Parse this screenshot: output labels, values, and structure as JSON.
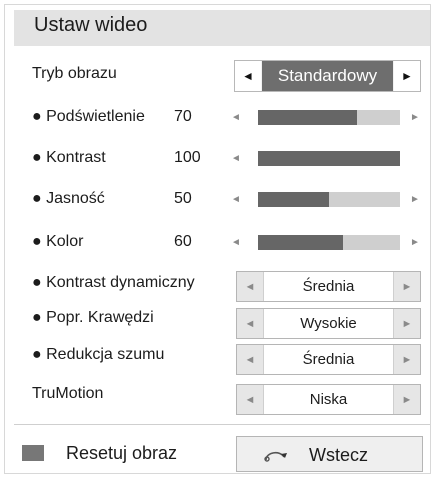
{
  "header": {
    "title": "Ustaw wideo"
  },
  "picture_mode": {
    "label": "Tryb obrazu",
    "value": "Standardowy",
    "left": "◄",
    "right": "►"
  },
  "sliders": [
    {
      "label": "● Podświetlenie",
      "value": "70",
      "level": 70
    },
    {
      "label": "● Kontrast",
      "value": "100",
      "level": 100
    },
    {
      "label": "● Jasność",
      "value": "50",
      "level": 50
    },
    {
      "label": "● Kolor",
      "value": "60",
      "level": 60
    }
  ],
  "selectors": [
    {
      "label": "● Kontrast dynamiczny",
      "value": "Średnia"
    },
    {
      "label": "● Popr. Krawędzi",
      "value": "Wysokie"
    },
    {
      "label": "● Redukcja szumu",
      "value": "Średnia"
    },
    {
      "label": "TruMotion",
      "value": "Niska"
    }
  ],
  "arrows": {
    "left": "◄",
    "right": "►"
  },
  "footer": {
    "reset_label": "Resetuj obraz",
    "back_label": "Wstecz"
  },
  "colors": {
    "title_bar": "#e3e3e3",
    "slider_fill": "#666666",
    "slider_track": "#cfcfcf",
    "mode_selected": "#6e6e6e"
  }
}
